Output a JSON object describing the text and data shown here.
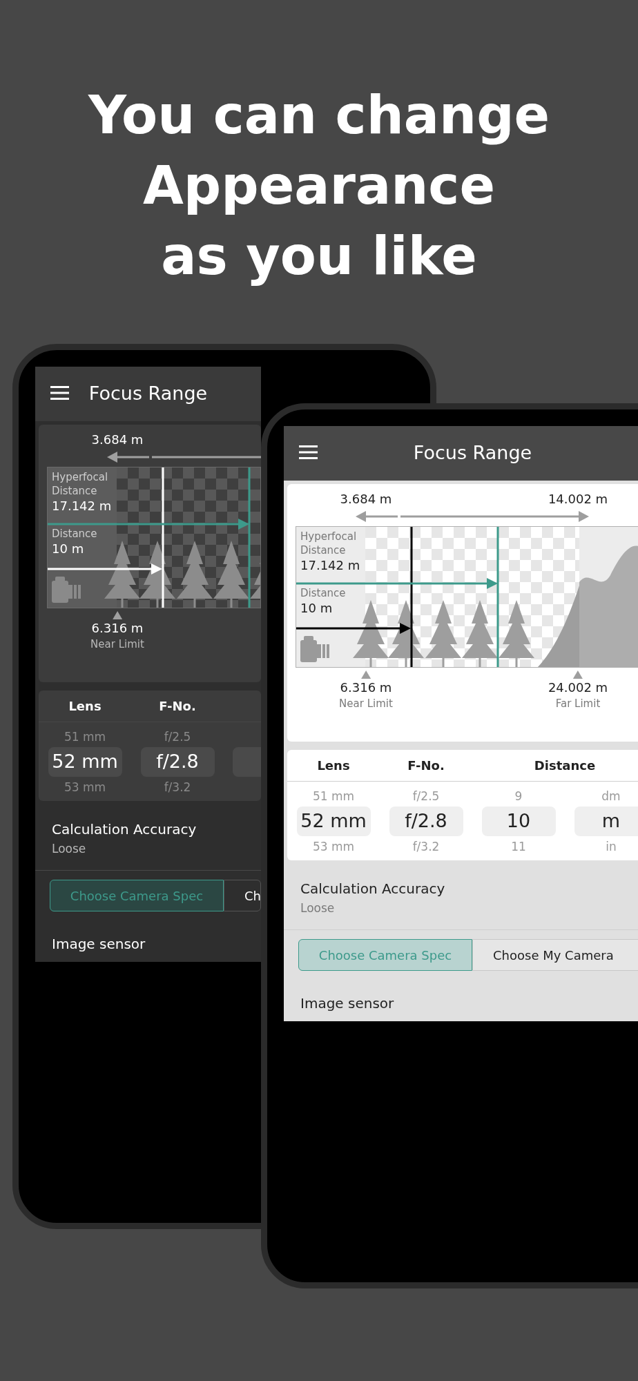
{
  "headline": [
    "You can change",
    "Appearance",
    "as you like"
  ],
  "phones": [
    {
      "dark_mode": true,
      "title": "Focus Range",
      "range": [
        "3.684 m"
      ],
      "hyperfocal": {
        "label": "Hyperfocal Distance",
        "value": "17.142 m"
      },
      "distance": {
        "label": "Distance",
        "value": "10 m"
      },
      "limits": [
        {
          "value": "6.316 m",
          "label": "Near Limit"
        }
      ],
      "picker": {
        "headers": [
          "Lens",
          "F-No."
        ],
        "columns": [
          {
            "kind": "wheel",
            "above": "51 mm",
            "value": "52 mm",
            "below": "53 mm"
          },
          {
            "kind": "wheel",
            "above": "f/2.5",
            "value": "f/2.8",
            "below": "f/3.2"
          },
          {
            "kind": "wheel"
          }
        ]
      },
      "setting": {
        "title": "Calculation Accuracy",
        "value": "Loose"
      },
      "buttons": [
        {
          "label": "Choose Camera Spec",
          "selected": true
        },
        {
          "label": "Ch",
          "selected": false
        }
      ],
      "section": "Image sensor"
    },
    {
      "dark_mode": false,
      "title": "Focus Range",
      "range": [
        "3.684 m",
        "14.002 m"
      ],
      "hyperfocal": {
        "label": "Hyperfocal Distance",
        "value": "17.142 m"
      },
      "distance": {
        "label": "Distance",
        "value": "10 m"
      },
      "limits": [
        {
          "value": "6.316 m",
          "label": "Near Limit"
        },
        {
          "value": "24.002 m",
          "label": "Far Limit"
        }
      ],
      "picker": {
        "headers": [
          "Lens",
          "F-No.",
          "Distance"
        ],
        "columns": [
          {
            "kind": "wheel",
            "above": "51 mm",
            "value": "52 mm",
            "below": "53 mm"
          },
          {
            "kind": "wheel",
            "above": "f/2.5",
            "value": "f/2.8",
            "below": "f/3.2"
          },
          {
            "kind": "wheel",
            "above": "9",
            "value": "10",
            "below": "11"
          },
          {
            "kind": "wheel",
            "above": "dm",
            "value": "m",
            "below": "in"
          }
        ]
      },
      "setting": {
        "title": "Calculation Accuracy",
        "value": "Loose"
      },
      "buttons": [
        {
          "label": "Choose Camera Spec",
          "selected": true
        },
        {
          "label": "Choose My Camera",
          "selected": false
        }
      ],
      "section": "Image sensor"
    }
  ]
}
